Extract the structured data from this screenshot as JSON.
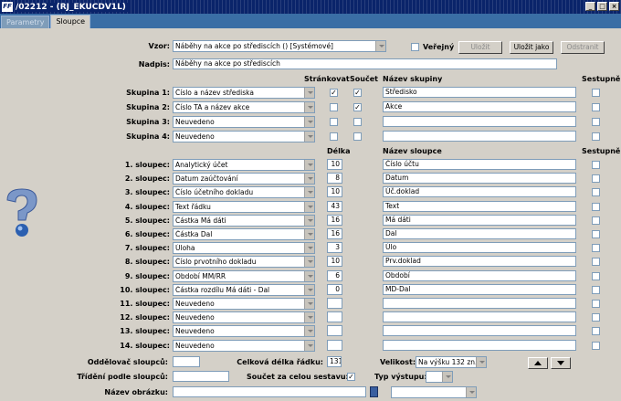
{
  "window": {
    "title": "/02212 - (RJ_EKUCDV1L)",
    "icon": "FF"
  },
  "tabs": [
    {
      "label": "Parametry"
    },
    {
      "label": "Sloupce"
    }
  ],
  "header": {
    "vzor_label": "Vzor:",
    "vzor_value": "Náběhy na akce po střediscích   ()   [Systémové]",
    "verejny_label": "Veřejný",
    "save_label": "Uložit",
    "save_as_label": "Uložit jako",
    "delete_label": "Odstranit",
    "nadpis_label": "Nadpis:",
    "nadpis_value": "Náběhy na akce po střediscích"
  },
  "groups": {
    "col_strankovat": "Stránkovat",
    "col_soucet": "Součet",
    "col_nazev": "Název skupiny",
    "col_sestupne": "Sestupně",
    "rows": [
      {
        "label": "Skupina 1:",
        "value": "Číslo a název střediska",
        "strankovat": "✓",
        "soucet": "✓",
        "name": "Středisko"
      },
      {
        "label": "Skupina 2:",
        "value": "Číslo TA a název akce",
        "strankovat": "",
        "soucet": "✓",
        "name": "Akce"
      },
      {
        "label": "Skupina 3:",
        "value": "Neuvedeno",
        "strankovat": "",
        "soucet": "",
        "name": ""
      },
      {
        "label": "Skupina 4:",
        "value": "Neuvedeno",
        "strankovat": "",
        "soucet": "",
        "name": ""
      }
    ]
  },
  "columns": {
    "col_delka": "Délka",
    "col_nazev": "Název sloupce",
    "col_sestupne": "Sestupně",
    "rows": [
      {
        "label": "1. sloupec:",
        "value": "Analytický účet",
        "len": "10",
        "name": "Číslo účtu"
      },
      {
        "label": "2. sloupec:",
        "value": "Datum zaúčtování",
        "len": "8",
        "name": "Datum"
      },
      {
        "label": "3. sloupec:",
        "value": "Číslo účetního dokladu",
        "len": "10",
        "name": "Úč.doklad"
      },
      {
        "label": "4. sloupec:",
        "value": "Text řádku",
        "len": "43",
        "name": "Text"
      },
      {
        "label": "5. sloupec:",
        "value": "Částka Má dáti",
        "len": "16",
        "name": "Má dáti"
      },
      {
        "label": "6. sloupec:",
        "value": "Částka Dal",
        "len": "16",
        "name": "Dal"
      },
      {
        "label": "7. sloupec:",
        "value": "Úloha",
        "len": "3",
        "name": "Úlo"
      },
      {
        "label": "8. sloupec:",
        "value": "Číslo prvotního dokladu",
        "len": "10",
        "name": "Prv.doklad"
      },
      {
        "label": "9. sloupec:",
        "value": "Období MM/RR",
        "len": "6",
        "name": "Období"
      },
      {
        "label": "10. sloupec:",
        "value": "Částka rozdílu Má dáti - Dal",
        "len": "0",
        "name": "MD-Dal"
      },
      {
        "label": "11. sloupec:",
        "value": "Neuvedeno",
        "len": "",
        "name": ""
      },
      {
        "label": "12. sloupec:",
        "value": "Neuvedeno",
        "len": "",
        "name": ""
      },
      {
        "label": "13. sloupec:",
        "value": "Neuvedeno",
        "len": "",
        "name": ""
      },
      {
        "label": "14. sloupec:",
        "value": "Neuvedeno",
        "len": "",
        "name": ""
      }
    ]
  },
  "footer": {
    "oddelovac_label": "Oddělovač sloupců:",
    "celkova_label": "Celková délka řádku:",
    "celkova_value": "131",
    "velikost_label": "Velikost:",
    "velikost_value": "Na výšku 132 zn.",
    "trideni_label": "Třídění podle sloupců:",
    "soucet_label": "Součet za celou sestavu:",
    "soucet_checked": "✓",
    "typ_label": "Typ výstupu:",
    "obrazek_label": "Název obrázku:"
  }
}
